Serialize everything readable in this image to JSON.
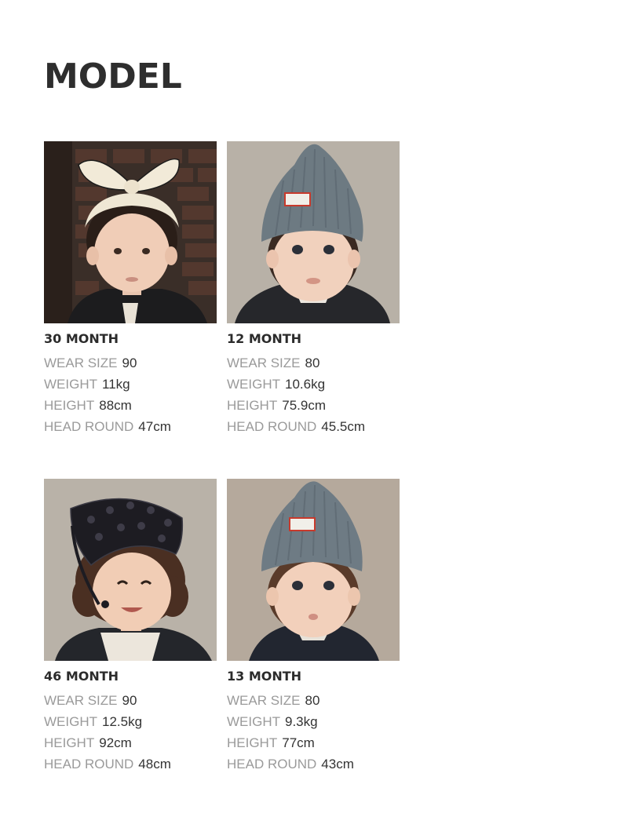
{
  "page": {
    "title": "MODEL"
  },
  "labels": {
    "wear_size": "WEAR SIZE",
    "weight": "WEIGHT",
    "height": "HEIGHT",
    "head_round": "HEAD ROUND"
  },
  "models": [
    {
      "age": "30 MONTH",
      "wear_size": "90",
      "weight": "11kg",
      "height": "88cm",
      "head_round": "47cm",
      "photo_icon": "child-with-bow-headband"
    },
    {
      "age": "12 MONTH",
      "wear_size": "80",
      "weight": "10.6kg",
      "height": "75.9cm",
      "head_round": "45.5cm",
      "photo_icon": "child-with-knit-beanie"
    },
    {
      "age": "46 MONTH",
      "wear_size": "90",
      "weight": "12.5kg",
      "height": "92cm",
      "head_round": "48cm",
      "photo_icon": "child-with-lace-bandana"
    },
    {
      "age": "13 MONTH",
      "wear_size": "80",
      "weight": "9.3kg",
      "height": "77cm",
      "head_round": "43cm",
      "photo_icon": "child-with-knit-beanie"
    }
  ],
  "colors": {
    "title": "#2e2e2e",
    "label": "#9a9a9a",
    "value": "#333333",
    "beanie": "#6d7a82",
    "backdrop": "#b9b2a8"
  }
}
